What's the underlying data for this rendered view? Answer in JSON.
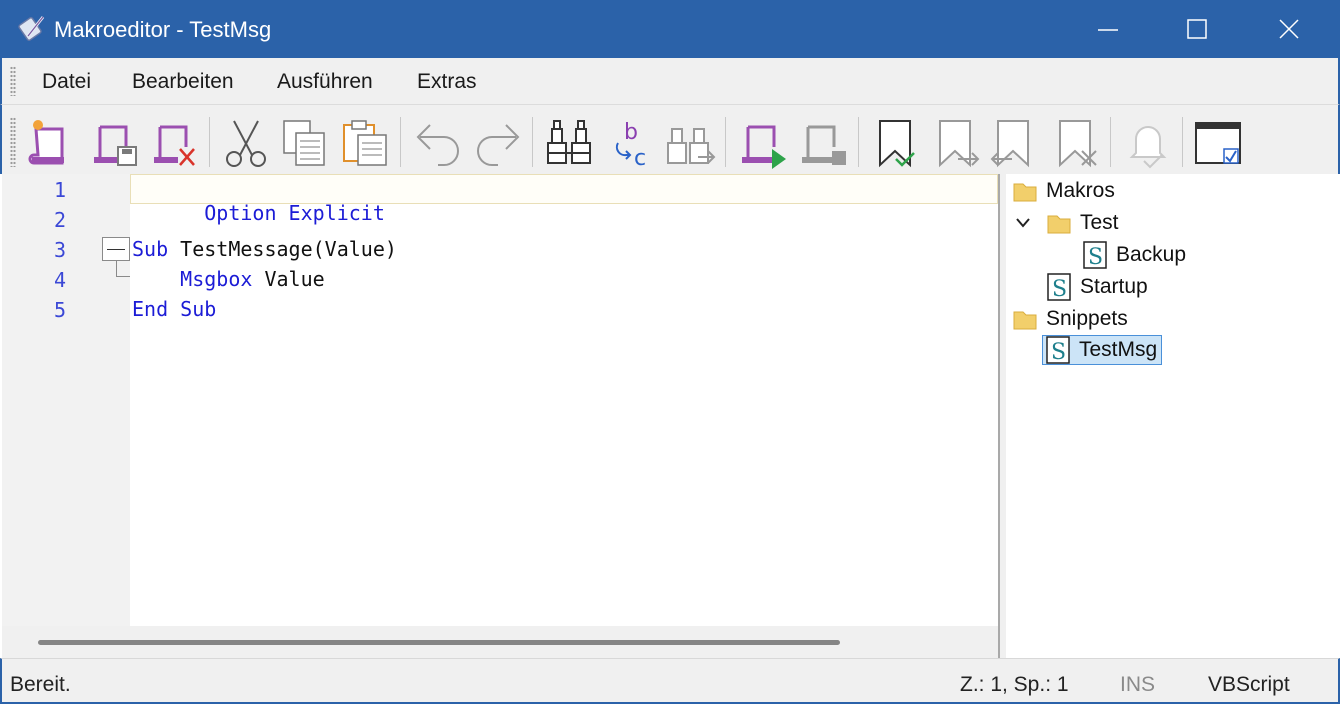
{
  "window": {
    "title": "Makroeditor - TestMsg",
    "title_bar_color": "#2b62a9",
    "controls": [
      "minimize-icon",
      "maximize-icon",
      "close-icon"
    ]
  },
  "menu": {
    "items": [
      {
        "label": "Datei"
      },
      {
        "label": "Bearbeiten"
      },
      {
        "label": "Ausführen"
      },
      {
        "label": "Extras"
      }
    ]
  },
  "toolbar": {
    "buttons": [
      {
        "icon": "new-macro-icon"
      },
      {
        "icon": "save-macro-icon"
      },
      {
        "icon": "delete-macro-icon"
      },
      {
        "icon": "cut-icon"
      },
      {
        "icon": "copy-icon"
      },
      {
        "icon": "paste-icon"
      },
      {
        "icon": "undo-icon"
      },
      {
        "icon": "redo-icon"
      },
      {
        "icon": "find-icon"
      },
      {
        "icon": "replace-icon"
      },
      {
        "icon": "find-next-icon"
      },
      {
        "icon": "run-macro-icon"
      },
      {
        "icon": "stop-macro-icon"
      },
      {
        "icon": "toggle-bookmark-icon"
      },
      {
        "icon": "next-bookmark-icon"
      },
      {
        "icon": "previous-bookmark-icon"
      },
      {
        "icon": "clear-bookmarks-icon"
      },
      {
        "icon": "notification-icon"
      },
      {
        "icon": "window-option-icon"
      }
    ]
  },
  "editor": {
    "lines": [
      {
        "no": "1",
        "tokens": [
          {
            "t": "Option Explicit",
            "kind": "keyword"
          }
        ]
      },
      {
        "no": "2",
        "tokens": []
      },
      {
        "no": "3",
        "tokens": [
          {
            "t": "Sub",
            "kind": "keyword"
          },
          {
            "t": " TestMessage(Value)",
            "kind": "text"
          }
        ]
      },
      {
        "no": "4",
        "tokens": [
          {
            "t": "    ",
            "kind": "text"
          },
          {
            "t": "Msgbox",
            "kind": "keyword"
          },
          {
            "t": " Value",
            "kind": "text"
          }
        ]
      },
      {
        "no": "5",
        "tokens": [
          {
            "t": "End Sub",
            "kind": "keyword"
          }
        ]
      }
    ],
    "colors": {
      "keyword": "#1c1cd6",
      "text": "#111111",
      "line_number": "#3b48d6"
    }
  },
  "tree": {
    "nodes": [
      {
        "label": "Makros",
        "type": "folder",
        "level": 0
      },
      {
        "label": "Test",
        "type": "folder",
        "level": 1,
        "expanded": true
      },
      {
        "label": "Backup",
        "type": "script",
        "level": 2
      },
      {
        "label": "Startup",
        "type": "script",
        "level": 1
      },
      {
        "label": "Snippets",
        "type": "folder",
        "level": 0
      },
      {
        "label": "TestMsg",
        "type": "script",
        "level": 1,
        "selected": true
      }
    ]
  },
  "status": {
    "message": "Bereit.",
    "position": "Z.: 1, Sp.: 1",
    "mode": "INS",
    "language": "VBScript"
  }
}
